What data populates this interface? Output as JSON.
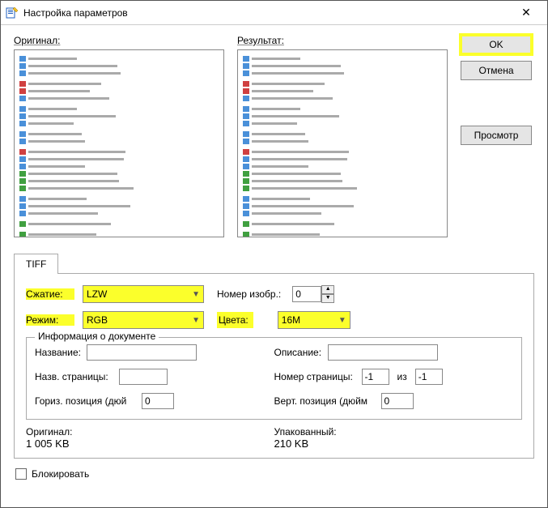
{
  "window": {
    "title": "Настройка параметров",
    "close_glyph": "✕"
  },
  "preview": {
    "original_label": "Оригинал:",
    "result_label": "Результат:"
  },
  "buttons": {
    "ok": "OK",
    "cancel": "Отмена",
    "preview": "Просмотр"
  },
  "tab": {
    "tiff": "TIFF"
  },
  "form": {
    "compression_label": "Сжатие:",
    "compression_value": "LZW",
    "mode_label": "Режим:",
    "mode_value": "RGB",
    "image_number_label": "Номер изобр.:",
    "image_number_value": "0",
    "colors_label": "Цвета:",
    "colors_value": "16M"
  },
  "docinfo": {
    "legend": "Информация о документе",
    "name_label": "Название:",
    "name_value": "",
    "desc_label": "Описание:",
    "desc_value": "",
    "pagename_label": "Назв. страницы:",
    "pagename_value": "",
    "pagenum_label": "Номер страницы:",
    "pagenum_value": "-1",
    "of_label": "из",
    "of_value": "-1",
    "hpos_label": "Гориз. позиция (дюй",
    "hpos_value": "0",
    "vpos_label": "Верт. позиция (дюйм",
    "vpos_value": "0"
  },
  "sizes": {
    "original_label": "Оригинал:",
    "original_value": "1 005 KB",
    "packed_label": "Упакованный:",
    "packed_value": "210 KB"
  },
  "lock_label": "Блокировать"
}
